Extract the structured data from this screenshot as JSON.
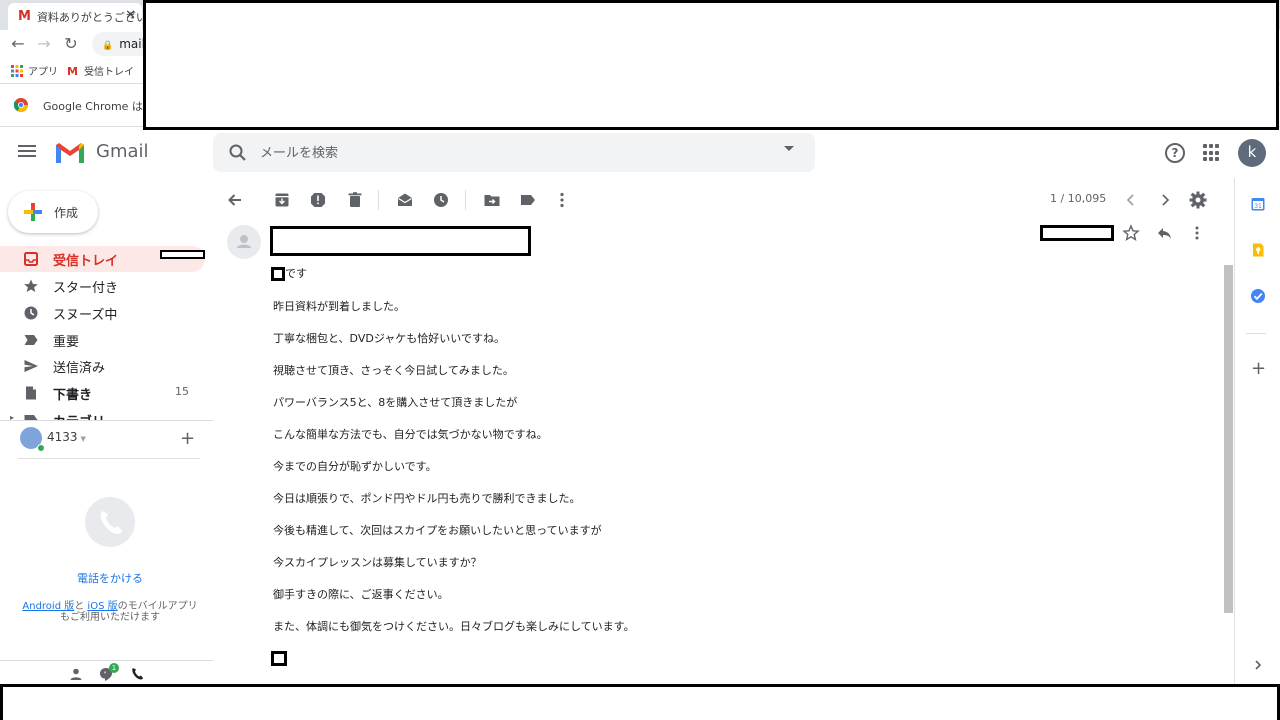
{
  "browser": {
    "tab_title": "資料ありがとうござい",
    "tab_close": "✕",
    "url": "mail.",
    "bookmarks": {
      "apps": "アプリ",
      "inbox": "受信トレイ"
    },
    "infobar_text": "Google Chrome はデ"
  },
  "header": {
    "app_name": "Gmail",
    "search_placeholder": "メールを検索",
    "help": "?",
    "avatar_letter": "k"
  },
  "sidebar": {
    "compose_label": "作成",
    "items": [
      {
        "label": "受信トレイ"
      },
      {
        "label": "スター付き"
      },
      {
        "label": "スヌーズ中"
      },
      {
        "label": "重要"
      },
      {
        "label": "送信済み"
      },
      {
        "label": "下書き",
        "count": "15"
      },
      {
        "label": "カテゴリ"
      }
    ],
    "hangouts_user": "4133",
    "call_label": "電話をかける",
    "mobile_note": {
      "android": "Android 版",
      "and": "と",
      "ios": "iOS 版",
      "rest1": "のモバイルアプリ",
      "rest2": "もご利用いただけます"
    },
    "badge_count": "1"
  },
  "toolbar": {
    "pager": "1 / 10,095"
  },
  "message": {
    "greeting_suffix": "です",
    "lines": [
      "昨日資料が到着しました。",
      "丁寧な梱包と、DVDジャケも恰好いいですね。",
      "視聴させて頂き、さっそく今日試してみました。",
      "パワーバランス5と、8を購入させて頂きましたが",
      "こんな簡単な方法でも、自分では気づかない物ですね。",
      "今までの自分が恥ずかしいです。",
      "今日は順張りで、ポンド円やドル円も売りで勝利できました。",
      "今後も精進して、次回はスカイプをお願いしたいと思っていますが",
      "今スカイプレッスンは募集していますか？",
      "御手すきの際に、ご返事ください。",
      "また、体調にも御気をつけください。日々ブログも楽しみにしています。"
    ]
  },
  "colors": {
    "accent_red": "#d93025",
    "link_blue": "#1a73e8",
    "inbox_bg": "#fce8e6"
  }
}
